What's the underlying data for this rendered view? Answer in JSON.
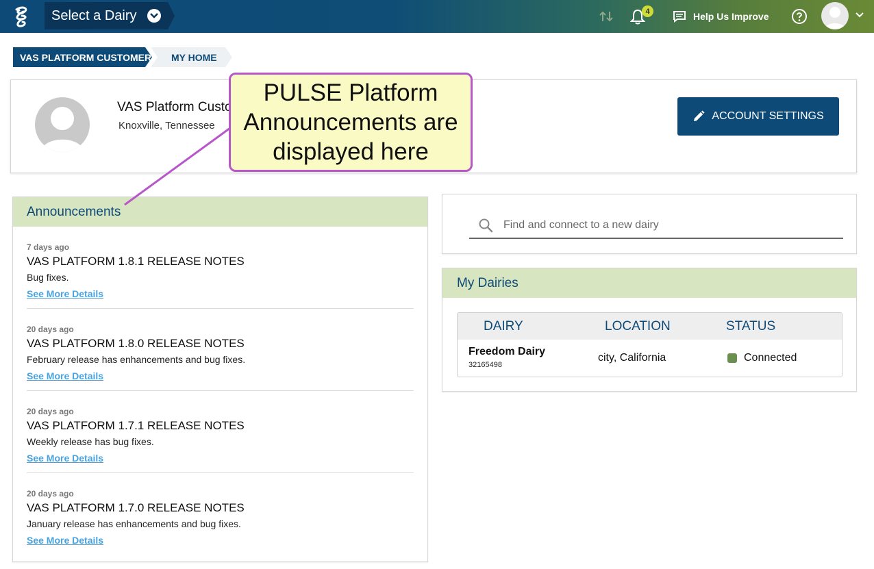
{
  "topbar": {
    "dairy_select_label": "Select a Dairy",
    "notification_count": "4",
    "help_improve_label": "Help Us Improve",
    "gradient_colors": [
      "#0d4a78",
      "#6a8a36"
    ]
  },
  "breadcrumb": {
    "items": [
      {
        "label": "VAS PLATFORM CUSTOMER"
      },
      {
        "label": "MY HOME"
      }
    ]
  },
  "profile": {
    "name": "VAS Platform Custo",
    "location": "Knoxville, Tennessee",
    "account_settings_label": "ACCOUNT SETTINGS"
  },
  "announcements": {
    "title": "Announcements",
    "items": [
      {
        "age": "7 days ago",
        "title": "VAS PLATFORM 1.8.1 RELEASE NOTES",
        "desc": "Bug fixes.",
        "link": "See More Details"
      },
      {
        "age": "20 days ago",
        "title": "VAS PLATFORM 1.8.0 RELEASE NOTES",
        "desc": "February release has enhancements and bug fixes.",
        "link": "See More Details"
      },
      {
        "age": "20 days ago",
        "title": "VAS PLATFORM 1.7.1 RELEASE NOTES",
        "desc": "Weekly release has bug fixes.",
        "link": "See More Details"
      },
      {
        "age": "20 days ago",
        "title": "VAS PLATFORM 1.7.0 RELEASE NOTES",
        "desc": "January release has enhancements and bug fixes.",
        "link": "See More Details"
      }
    ]
  },
  "search": {
    "placeholder": "Find and connect to a new dairy"
  },
  "my_dairies": {
    "title": "My Dairies",
    "columns": [
      "DAIRY",
      "LOCATION",
      "STATUS"
    ],
    "rows": [
      {
        "name": "Freedom Dairy",
        "id": "32165498",
        "location": "city, California",
        "status": "Connected",
        "status_color": "#6a8f4e"
      }
    ]
  },
  "callout": {
    "lines": [
      "PULSE Platform",
      "Announcements are",
      "displayed here"
    ]
  }
}
